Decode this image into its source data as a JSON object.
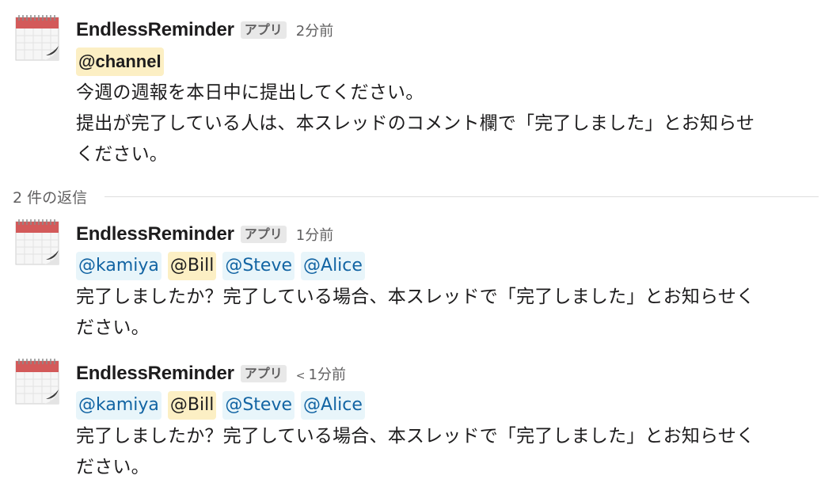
{
  "parent": {
    "sender": "EndlessReminder",
    "badge": "アプリ",
    "timestamp": "2分前",
    "mention": "@channel",
    "lines": [
      "今週の週報を本日中に提出してください。",
      "提出が完了している人は、本スレッドのコメント欄で「完了しました」とお知らせ",
      "ください。"
    ]
  },
  "replies_label": "2 件の返信",
  "replies": [
    {
      "sender": "EndlessReminder",
      "badge": "アプリ",
      "thread_marker": "",
      "timestamp": "1分前",
      "mentions": [
        "@kamiya",
        "@Bill",
        "@Steve",
        "@Alice"
      ],
      "lines": [
        "完了しましたか？完了している場合、本スレッドで「完了しました」とお知らせく",
        "ださい。"
      ]
    },
    {
      "sender": "EndlessReminder",
      "badge": "アプリ",
      "thread_marker": "<",
      "timestamp": "1分前",
      "mentions": [
        "@kamiya",
        "@Bill",
        "@Steve",
        "@Alice"
      ],
      "lines": [
        "完了しましたか？完了している場合、本スレッドで「完了しました」とお知らせく",
        "ださい。"
      ]
    }
  ],
  "icons": {
    "avatar": "calendar-icon"
  },
  "colors": {
    "mention_bg": "#e8f5fa",
    "mention_text": "#1264a3",
    "highlight_bg": "#fcefc4",
    "calendar_red": "#d35a5a"
  }
}
